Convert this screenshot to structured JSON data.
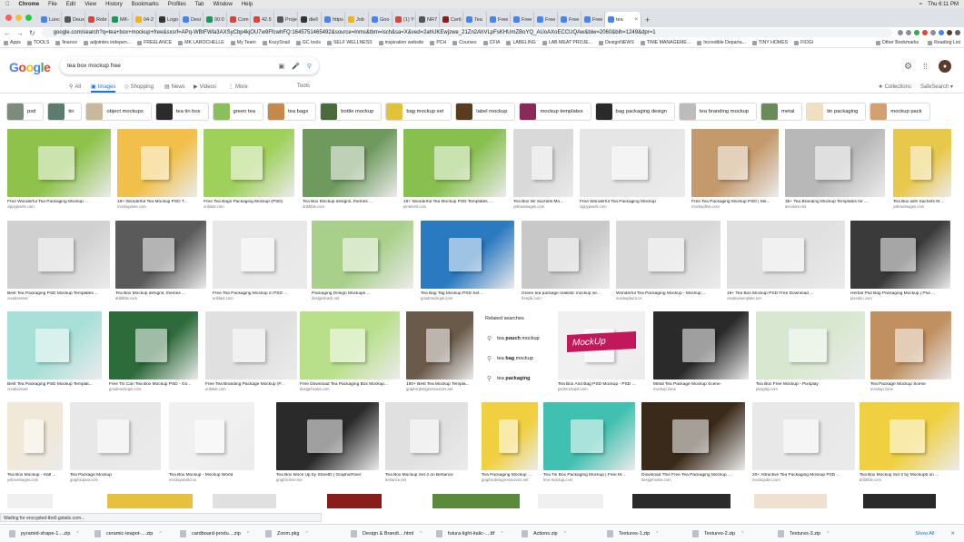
{
  "menubar": {
    "app": "Chrome",
    "items": [
      "File",
      "Edit",
      "View",
      "History",
      "Bookmarks",
      "Profiles",
      "Tab",
      "Window",
      "Help"
    ],
    "clock": "Thu 6:11 PM"
  },
  "tabs": [
    {
      "label": "Lunc",
      "color": "#4285f4"
    },
    {
      "label": "Deux",
      "color": "#555"
    },
    {
      "label": "Rebr",
      "color": "#db4437"
    },
    {
      "label": "MK-",
      "color": "#0f9d58"
    },
    {
      "label": "04-2",
      "color": "#f4b400"
    },
    {
      "label": "Logo",
      "color": "#333"
    },
    {
      "label": "Desi",
      "color": "#4285f4"
    },
    {
      "label": "00:0",
      "color": "#0f9d58"
    },
    {
      "label": "Com",
      "color": "#db4437"
    },
    {
      "label": "42.5",
      "color": "#db4437"
    },
    {
      "label": "Proje",
      "color": "#555"
    },
    {
      "label": "diell",
      "color": "#333"
    },
    {
      "label": "https",
      "color": "#4285f4"
    },
    {
      "label": "Job",
      "color": "#f4b400"
    },
    {
      "label": "Goo",
      "color": "#4285f4"
    },
    {
      "label": "(1) Y",
      "color": "#db4437"
    },
    {
      "label": "NR7",
      "color": "#555"
    },
    {
      "label": "Certi",
      "color": "#8b1c1c"
    },
    {
      "label": "Tea",
      "color": "#4285f4"
    },
    {
      "label": "Free",
      "color": "#4285f4"
    },
    {
      "label": "Free",
      "color": "#4285f4"
    },
    {
      "label": "Free",
      "color": "#4285f4"
    },
    {
      "label": "Free",
      "color": "#4285f4"
    },
    {
      "label": "Free",
      "color": "#4285f4"
    }
  ],
  "active_tab": {
    "label": "tea"
  },
  "address": "google.com/search?q=tea+box+mockup+free&sxsrf=APq-WBtFWla3AXSyCbp4kjOU7w9FfcwhFQ:1645751465492&source=lnms&tbm=isch&sa=X&ved=2ahUKEwjzwe_21Zn2AhVLpFsKHUmZBoYQ_AUoAXoECCUQAw&biw=2060&bih=1249&dpr=1",
  "bookmarks": {
    "left": [
      "Apps",
      "TOOLS",
      "finance",
      "adjointes indepen...",
      "FREELANCE",
      "MK LAROCHELLE",
      "My Team",
      "KozySnail",
      "GC tools",
      "SELF WELLNESS",
      "inspiration website",
      "PCH",
      "Courses",
      "CFIA",
      "LABELING",
      "LAB MEAT PROJE...",
      "DesignNEWS",
      "TIME MANAGEME...",
      "Incredible Departa...",
      "TINY HOMES",
      "FIOGI"
    ],
    "right": [
      "Other Bookmarks",
      "Reading List"
    ]
  },
  "google": {
    "logo": "Google",
    "query": "tea box mockup free",
    "tabs": [
      "All",
      "Images",
      "Shopping",
      "News",
      "Videos",
      "More",
      "Tools"
    ],
    "collections": "Collections",
    "safesearch": "SafeSearch"
  },
  "chips": [
    {
      "label": "psd",
      "color": "#7d8a7e"
    },
    {
      "label": "tin",
      "color": "#5a7d6d"
    },
    {
      "label": "object mockups",
      "color": "#c9b89a"
    },
    {
      "label": "tea tin box",
      "color": "#2b2b2b"
    },
    {
      "label": "green tea",
      "color": "#8bbf5a"
    },
    {
      "label": "tea bags",
      "color": "#c58a4a"
    },
    {
      "label": "bottle mockup",
      "color": "#4c6b3a"
    },
    {
      "label": "bag mockup set",
      "color": "#e2c23b"
    },
    {
      "label": "label mockup",
      "color": "#5a3b1c"
    },
    {
      "label": "mockup templates",
      "color": "#8a2a5a"
    },
    {
      "label": "bag packaging design",
      "color": "#2a2a2a"
    },
    {
      "label": "tea branding mockup",
      "color": "#bcbcbc"
    },
    {
      "label": "metal",
      "color": "#6b8a5a"
    },
    {
      "label": "tin packaging",
      "color": "#f0e0c0"
    },
    {
      "label": "mockup pack",
      "color": "#d4a070"
    }
  ],
  "images": [
    {
      "cap": "Free Wonderful Tea Packaging Mockup ...",
      "src": "zippypixels.com",
      "color": "#8ec24a"
    },
    {
      "cap": "19+ Wonderful Tea Mockup PSD T...",
      "src": "mockupmee.com",
      "color": "#f1c04a"
    },
    {
      "cap": "Free Tea Bags Packaging Mockup (PSD)",
      "src": "unblast.com",
      "color": "#9fd05a"
    },
    {
      "cap": "Tea Box Mockup designs, themes ...",
      "src": "dribbble.com",
      "color": "#6f9a5e"
    },
    {
      "cap": "19+ Wonderful Tea Mockup PSD Templates ...",
      "src": "pinterest.com",
      "color": "#88c050"
    },
    {
      "cap": "Tea Box W/ Sachets Mo...",
      "src": "yellowimages.com",
      "color": "#d9d9d9"
    },
    {
      "cap": "Free Wonderful Tea Packaging Mockup",
      "src": "zippypixels.com",
      "color": "#e6e6e6"
    },
    {
      "cap": "Free Tea Packaging Mockup PSD | Mo...",
      "src": "mockupfree.com",
      "color": "#c49a6c"
    },
    {
      "cap": "35+ Tea Branding Mockup Templates for ...",
      "src": "decolore.net",
      "color": "#b8b8b8"
    },
    {
      "cap": "Tea Box with Sachets M...",
      "src": "yellowimages.com",
      "color": "#e8c84a"
    },
    {
      "cap": "Best Tea Packaging PSD Mockup Templates ...",
      "src": "creativesnet",
      "color": "#d0d0d0"
    },
    {
      "cap": "Tea Box Mockup designs, themes ...",
      "src": "dribbble.com",
      "color": "#5a5a5a"
    },
    {
      "cap": "Free Tea Packaging Mockup in PSD ...",
      "src": "unblast.com",
      "color": "#e8e8e8"
    },
    {
      "cap": "Packaging Design Mockups ...",
      "src": "designshack.net",
      "color": "#a8d08a"
    },
    {
      "cap": "Tea Bag Tag Mockup PSD Set ...",
      "src": "goodmockups.com",
      "color": "#2a7ac0"
    },
    {
      "cap": "Green tea package realistic mockup se...",
      "src": "freepik.com",
      "color": "#c8c8c8"
    },
    {
      "cap": "Wonderful Tea Packaging Mockup - Mockup ...",
      "src": "mockuphunt.co",
      "color": "#d8d8d8"
    },
    {
      "cap": "18+ Tea Box Mockup PSD Free Download ...",
      "src": "creativetemplate.net",
      "color": "#e0e0e0"
    },
    {
      "cap": "Herbal Psd Bag Packaging Mockup | Psd ...",
      "src": "pixeden.com",
      "color": "#3a3a3a"
    },
    {
      "cap": "Best Tea Packaging PSD Mockup Templat...",
      "src": "creativesnet",
      "color": "#a8e0d8"
    },
    {
      "cap": "Free Tin Can Tea Box Mockup PSD - Go...",
      "src": "goodmockups.com",
      "color": "#2d6b3a"
    },
    {
      "cap": "Free Tea Branding Package Mockup (P...",
      "src": "unblast.com",
      "color": "#e0e0e0"
    },
    {
      "cap": "Free Download Tea Packaging Box Mockup...",
      "src": "designhooks.com",
      "color": "#b8e08a"
    },
    {
      "cap": "190+ Best Tea Mockup Templa...",
      "src": "graphicdesignresources.net",
      "color": "#6a5a4a"
    },
    {
      "cap": "Tea Box And Bag PSD Mockup - PSD ...",
      "src": "psdmockups.com",
      "color": "#f0f0f0"
    },
    {
      "cap": "Metal Tea Package Mockup Scene",
      "src": "mockup.zone",
      "color": "#2a2a2a"
    },
    {
      "cap": "Tea Box Free Mockup - Pixsplay",
      "src": "pixsplay.com",
      "color": "#d8e8d0"
    },
    {
      "cap": "Tea Package Mockup Scene",
      "src": "mockup.zone",
      "color": "#c09060"
    },
    {
      "cap": "Tea Box Mockup - Half ...",
      "src": "yellowimages.com",
      "color": "#f0e8d8"
    },
    {
      "cap": "Tea Package Mockup",
      "src": "graphicpear.com",
      "color": "#e8e8e8"
    },
    {
      "cap": "Tea Box Mockup - Mockup World",
      "src": "mockupworld.co",
      "color": "#f0f0f0"
    },
    {
      "cap": "Tea Box Mock Up by StreetD | GraphicRiver",
      "src": "graphicriver.net",
      "color": "#2a2a2a"
    },
    {
      "cap": "Tea Box Mockup Set 2 on Behance",
      "src": "behance.net",
      "color": "#e0e0e0"
    },
    {
      "cap": "Tea Packaging Mockup ...",
      "src": "graphicdesignresources.net",
      "color": "#f0d040"
    },
    {
      "cap": "Tea Tin Box Packaging Mockup | Free M...",
      "src": "free-mockup.com",
      "color": "#40c0b0"
    },
    {
      "cap": "Download This Free Tea Packaging Mockup ...",
      "src": "designhooks.com",
      "color": "#3a2a1a"
    },
    {
      "cap": "20+ Attractive Tea Packaging Mockup PSD ...",
      "src": "mockupden.com",
      "color": "#e8e8e8"
    },
    {
      "cap": "Tea Box Mockup Set 2 by Mockup5 on ...",
      "src": "dribbble.com",
      "color": "#f0d040"
    }
  ],
  "mockup_overlay_text": "MockUp",
  "related": {
    "title": "Related searches",
    "items": [
      {
        "pre": "tea ",
        "bold": "pouch",
        "post": " mockup"
      },
      {
        "pre": "tea ",
        "bold": "bag",
        "post": " mockup"
      },
      {
        "pre": "tea ",
        "bold": "packaging",
        "post": ""
      }
    ]
  },
  "status_text": "Waiting for encrypted-tbn0.gstatic.com...",
  "downloads": [
    "pyramid-shape-1....zip",
    "ceramic-teapot-....zip",
    "cardboard-produ....zip",
    "Zoom.pkg",
    "Design & Brandi....html",
    "futura-light-italic-....ttf",
    "Actions.zip",
    "Textures-1.zip",
    "Textures-2.zip",
    "Textures-3.zip"
  ],
  "show_all": "Show All",
  "colors": {
    "accent": "#1a73e8",
    "google_blue": "#4285f4",
    "google_red": "#ea4335",
    "google_yellow": "#fbbc05",
    "google_green": "#34a853"
  }
}
